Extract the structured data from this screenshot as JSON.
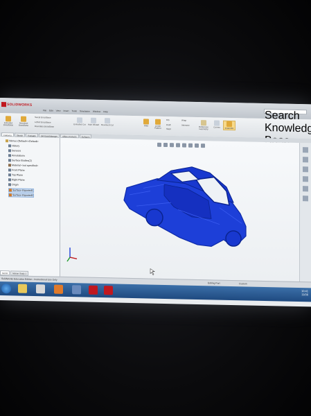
{
  "app": {
    "logo_text": "SOLIDWORKS",
    "menu": [
      "File",
      "Edit",
      "View",
      "Insert",
      "Tools",
      "Simulation",
      "Window",
      "Help"
    ],
    "search_placeholder": "Search Knowledge Base"
  },
  "ribbon": {
    "buttons": [
      "Extruded Boss/Base",
      "Revolved Boss/Base",
      "Swept Boss/Base",
      "Lofted Boss/Base",
      "Boundary Boss/Base",
      "Extruded Cut",
      "Hole Wizard",
      "Revolved Cut",
      "Fillet",
      "Linear Pattern",
      "Rib",
      "Draft",
      "Shell",
      "Wrap",
      "Intersect",
      "Reference Geometry",
      "Curves",
      "Instant3D"
    ]
  },
  "command_tabs": [
    "Features",
    "Sketch",
    "Evaluate",
    "DimXpertManager",
    "Office Products",
    "Surfaces"
  ],
  "feature_tree": {
    "items": [
      {
        "label": "Ninnuo (Default<<Default>",
        "icon_color": "#c8a24a"
      },
      {
        "label": "History",
        "icon_color": "#6a7b90"
      },
      {
        "label": "Sensors",
        "icon_color": "#6a7b90"
      },
      {
        "label": "Annotations",
        "icon_color": "#6a7b90"
      },
      {
        "label": "Surface Bodies(2)",
        "icon_color": "#6a7b90"
      },
      {
        "label": "Material <not specified>",
        "icon_color": "#8a6b4a"
      },
      {
        "label": "Front Plane",
        "icon_color": "#6a7b90"
      },
      {
        "label": "Top Plane",
        "icon_color": "#6a7b90"
      },
      {
        "label": "Right Plane",
        "icon_color": "#6a7b90"
      },
      {
        "label": "Origin",
        "icon_color": "#6a7b90"
      },
      {
        "label": "Surface-Imported1",
        "icon_color": "#d07a2a",
        "selected": true
      },
      {
        "label": "Surface-Imported2",
        "icon_color": "#d07a2a",
        "selected": true
      }
    ]
  },
  "bottom_tabs": [
    "Model",
    "Motion Study 1"
  ],
  "status": {
    "left": "SolidWorks Education Edition - Instructional Use Only",
    "editing": "Editing Part",
    "units": "Custom"
  },
  "model": {
    "color": "#1a3fd6"
  },
  "taskbar": {
    "time": "10:41",
    "date": "11/06"
  }
}
